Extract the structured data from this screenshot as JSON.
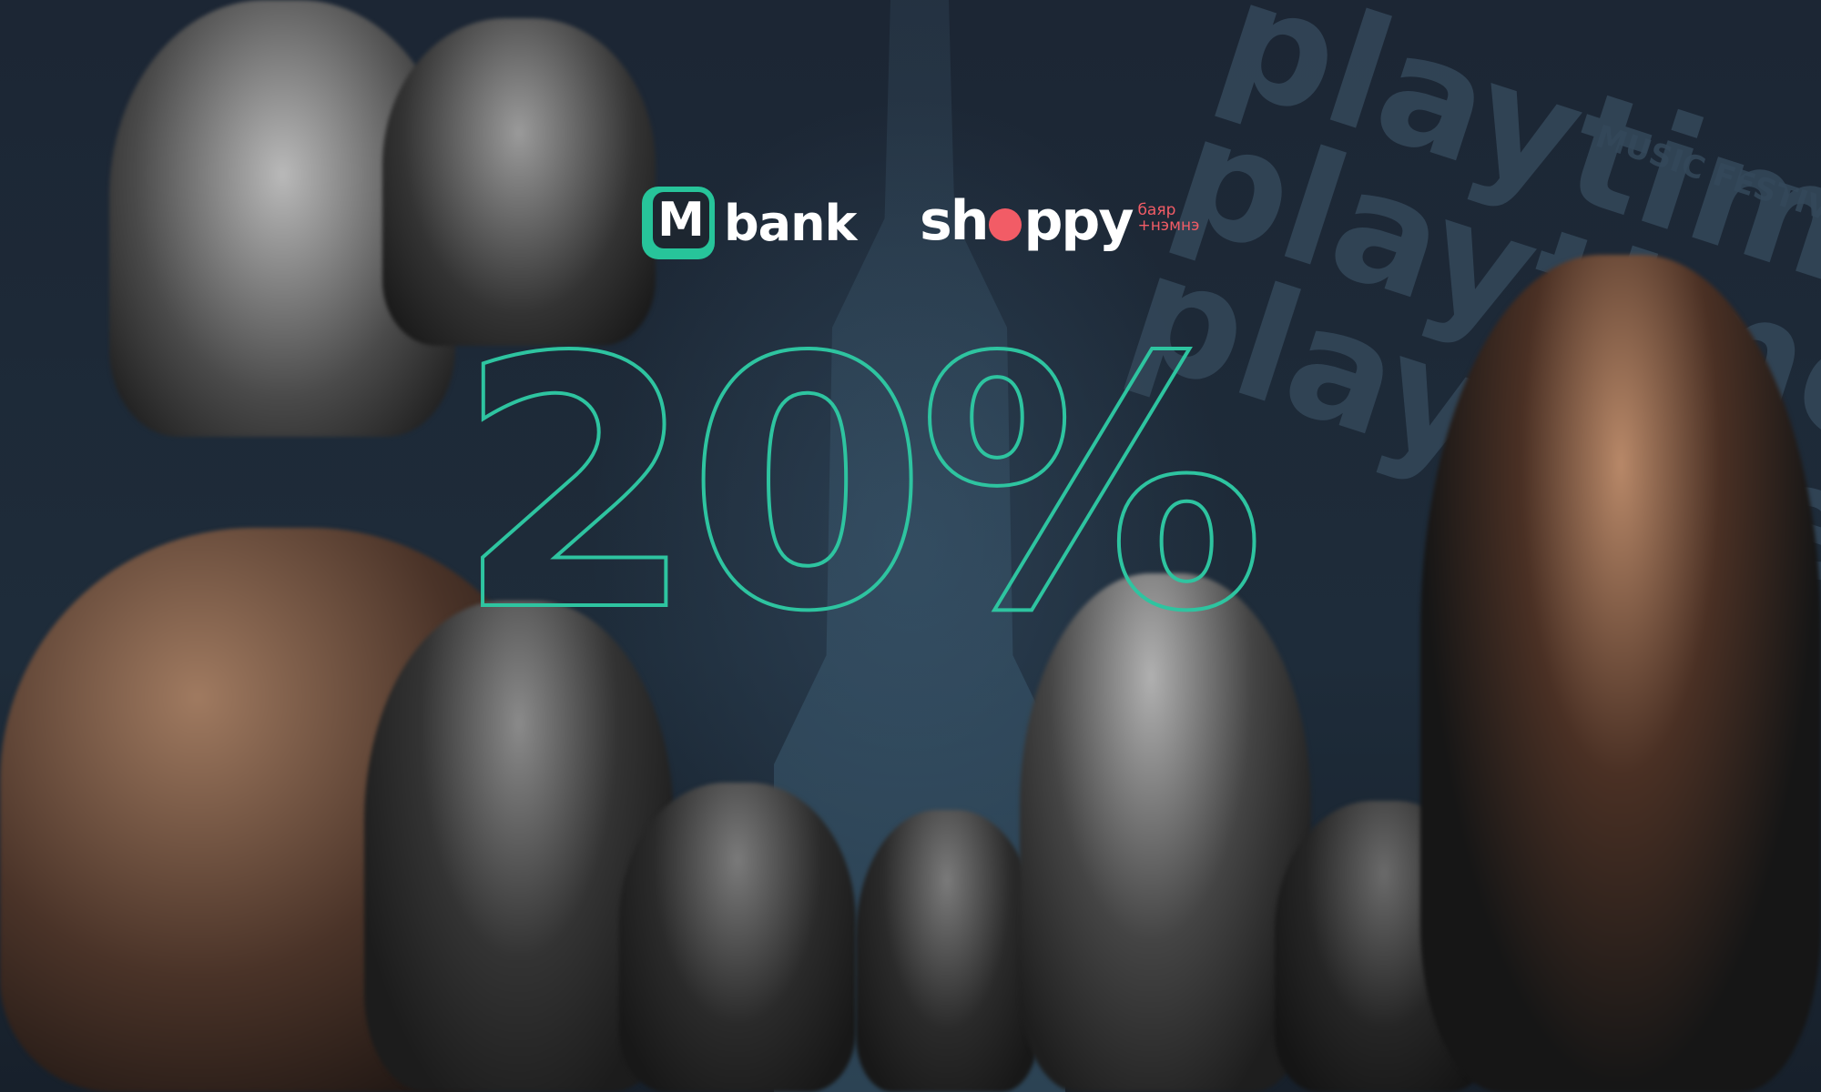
{
  "watermark": {
    "word": "playtime",
    "subtitle": "MUSIC FESTIVAL"
  },
  "logos": {
    "mbank": {
      "letter": "M",
      "name": "bank",
      "color": "#27c49a"
    },
    "shoppy": {
      "pre": "sh",
      "post": "ppy",
      "tagline_line1": "баяр",
      "tagline_line2": "+нэмнэ",
      "accent": "#f25c66"
    }
  },
  "headline": {
    "discount": "20%",
    "stroke_color": "#2ec4a0"
  }
}
